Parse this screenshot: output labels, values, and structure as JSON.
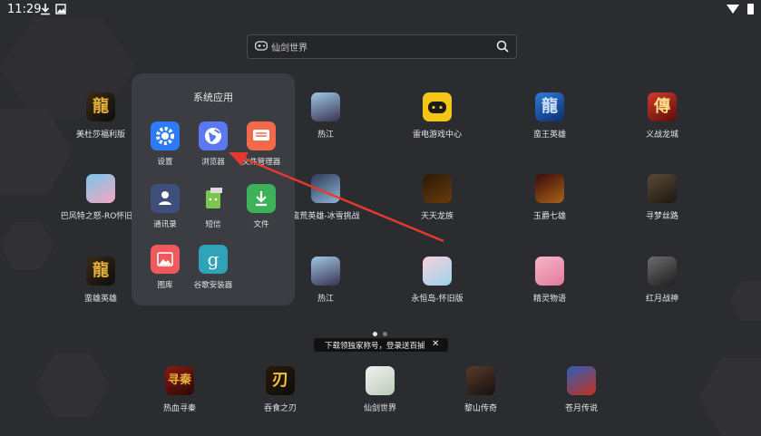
{
  "status": {
    "time": "11:29"
  },
  "search": {
    "placeholder": "仙剑世界"
  },
  "folder": {
    "title": "系统应用",
    "apps": [
      {
        "label": "设置",
        "icon": "settings-icon",
        "color": "#2d7bf6"
      },
      {
        "label": "浏览器",
        "icon": "browser-icon",
        "color": "#5c77f2"
      },
      {
        "label": "文件管理器",
        "icon": "file-manager-icon",
        "color": "#f26a4a"
      },
      {
        "label": "通讯录",
        "icon": "contacts-icon",
        "color": "#3d4f7a"
      },
      {
        "label": "短信",
        "icon": "messages-icon",
        "color": "#7bc74d"
      },
      {
        "label": "文件",
        "icon": "download-icon",
        "color": "#3db25b"
      },
      {
        "label": "图库",
        "icon": "gallery-icon",
        "color": "#f0595c"
      },
      {
        "label": "谷歌安装器",
        "icon": "google-installer-icon",
        "color": "#2fa3b8"
      }
    ]
  },
  "apps": {
    "row1": [
      "美杜莎福利版",
      "热江",
      "雷电游戏中心",
      "蛮王英雄",
      "义战龙城"
    ],
    "row2": [
      "巴风特之怒-RO怀旧服",
      "蛮荒英雄-冰雪挑战",
      "天天龙族",
      "玉爵七雄",
      "寻梦丝路"
    ],
    "row3": [
      "蛮雄英雄",
      "热江",
      "永恒岛-怀旧版",
      "精灵物语",
      "红月战神"
    ]
  },
  "dock": [
    "热血寻秦",
    "吞食之刃",
    "仙剑世界",
    "黎山传奇",
    "苍月传说"
  ],
  "toast": {
    "text": "下载领独家称号，登录送百抽",
    "close": "✕"
  },
  "colors": {
    "background": "#2b2c30",
    "folder_bg": "#3c3d43",
    "arrow": "#e23b2e"
  }
}
